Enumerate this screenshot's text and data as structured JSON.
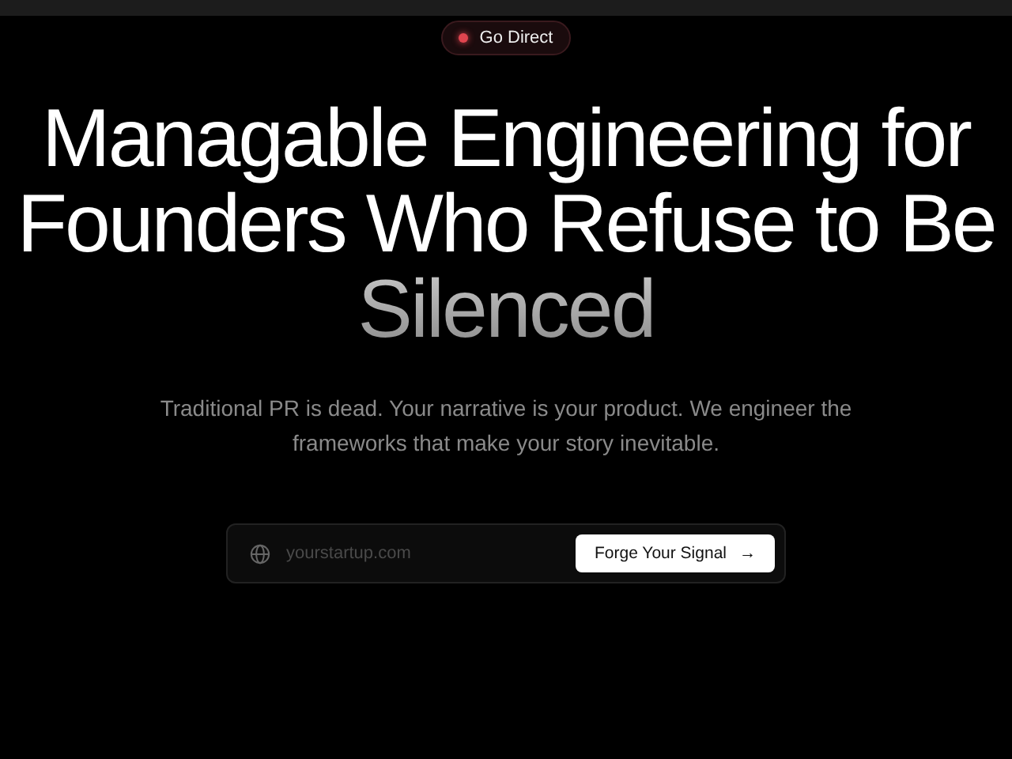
{
  "badge": {
    "label": "Go Direct"
  },
  "heading": [
    {
      "text": "Managable Engineering for",
      "kind": "plain"
    },
    {
      "text": "Founders Who Refuse to Be",
      "kind": "plain"
    },
    {
      "text": "Silenced",
      "kind": "muted"
    }
  ],
  "subtitle": "Traditional PR is dead. Your narrative is your product. We engineer the frameworks that make your story inevitable.",
  "form": {
    "placeholder": "yourstartup.com",
    "button": "Forge Your Signal",
    "button_icon": "→"
  }
}
